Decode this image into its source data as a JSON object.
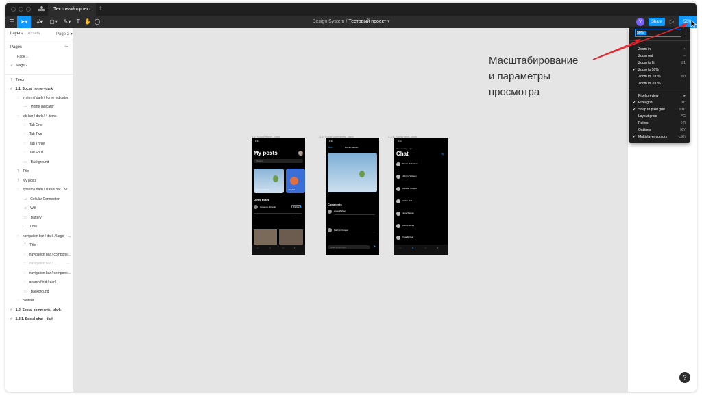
{
  "titlebar": {
    "tab_title": "Тестовый проект",
    "plus": "+"
  },
  "toolbar": {
    "breadcrumb_team": "Design System",
    "breadcrumb_sep": "/",
    "breadcrumb_file": "Тестовый проект",
    "avatar_letter": "V",
    "share_label": "Share",
    "zoom_value": "50%"
  },
  "layers_panel": {
    "tab_layers": "Layers",
    "tab_assets": "Assets",
    "page_selector": "Page 2",
    "pages_heading": "Pages",
    "add_page": "+",
    "pages": [
      "Page 1",
      "Page 2"
    ],
    "current_page_check": "✔",
    "layers": [
      {
        "label": "Текст",
        "glyph": "T"
      },
      {
        "label": "1.1. Social home - dark",
        "glyph": "#"
      },
      {
        "label": "system / dark / home indicator",
        "glyph": "::"
      },
      {
        "label": "Home Indicator",
        "glyph": "—"
      },
      {
        "label": "tab bar / dark / 4 items",
        "glyph": "::"
      },
      {
        "label": "Tab One",
        "glyph": "::"
      },
      {
        "label": "Tab Two",
        "glyph": "::"
      },
      {
        "label": "Tab Three",
        "glyph": "::"
      },
      {
        "label": "Tab Four",
        "glyph": "::"
      },
      {
        "label": "Background",
        "glyph": "▭"
      },
      {
        "label": "Title",
        "glyph": "T"
      },
      {
        "label": "My posts",
        "glyph": "T"
      },
      {
        "label": "system / dark / status bar / 3e...",
        "glyph": "::"
      },
      {
        "label": "Cellular Connection",
        "glyph": "⊿"
      },
      {
        "label": "Wifi",
        "glyph": "≋"
      },
      {
        "label": "Battery",
        "glyph": "▭"
      },
      {
        "label": "Time",
        "glyph": "T"
      },
      {
        "label": "navigation bar / dark / large + ...",
        "glyph": "::"
      },
      {
        "label": "Title",
        "glyph": "T"
      },
      {
        "label": "navigation bar / compone...",
        "glyph": "::"
      },
      {
        "label": "navigation bar / ...",
        "glyph": "::"
      },
      {
        "label": "navigation bar / compone...",
        "glyph": "::"
      },
      {
        "label": "search field / dark",
        "glyph": "::"
      },
      {
        "label": "Background",
        "glyph": "▭"
      },
      {
        "label": "content",
        "glyph": "::"
      },
      {
        "label": "1.2. Social comments - dark",
        "glyph": "#"
      },
      {
        "label": "1.3.1. Social chat - dark",
        "glyph": "#"
      }
    ]
  },
  "canvas": {
    "frames": [
      {
        "label": "1.1. Social home - dark"
      },
      {
        "label": "1.2. Social comments - dark"
      },
      {
        "label": "1.3.1. Social chat - dark"
      }
    ],
    "home": {
      "time": "9:41",
      "title": "My posts",
      "search": "Search",
      "card_caption": "Hot air balloon",
      "card2_caption": "Jellyfish",
      "other_posts": "Other posts",
      "author": "Cameron Stewart",
      "follow": "Follow"
    },
    "comments": {
      "time": "9:41",
      "back": "Back",
      "title": "Hot air balloon",
      "heading": "Comments",
      "user1": "Ange Walton",
      "user2": "Kathryn Cooper",
      "input": "Write a comment"
    },
    "chat": {
      "time": "9:41",
      "subtitle": "Wednesday, June",
      "title": "Chat",
      "contacts": [
        "Nicole Robertson",
        "Johnny Watson",
        "Annette Cooper",
        "Arthur Bell",
        "Jane Warren",
        "Morris Henry",
        "Irma Flores"
      ]
    }
  },
  "view_menu": {
    "input_value": "50%",
    "items_group1": [
      {
        "label": "Zoom in",
        "shortcut": "+",
        "checked": false
      },
      {
        "label": "Zoom out",
        "shortcut": "−",
        "checked": false
      },
      {
        "label": "Zoom to fit",
        "shortcut": "⇧1",
        "checked": false
      },
      {
        "label": "Zoom to 50%",
        "shortcut": "",
        "checked": true
      },
      {
        "label": "Zoom to 100%",
        "shortcut": "⇧0",
        "checked": false
      },
      {
        "label": "Zoom to 200%",
        "shortcut": "",
        "checked": false
      }
    ],
    "items_group2": [
      {
        "label": "Pixel preview",
        "shortcut": "▸",
        "checked": false
      },
      {
        "label": "Pixel grid",
        "shortcut": "⌘'",
        "checked": true
      },
      {
        "label": "Snap to pixel grid",
        "shortcut": "⇧⌘'",
        "checked": true
      },
      {
        "label": "Layout grids",
        "shortcut": "^G",
        "checked": false
      },
      {
        "label": "Rulers",
        "shortcut": "⇧R",
        "checked": false
      },
      {
        "label": "Outlines",
        "shortcut": "⌘Y",
        "checked": false
      },
      {
        "label": "Multiplayer cursors",
        "shortcut": "⌥⌘\\",
        "checked": true
      }
    ],
    "check_glyph": "✔"
  },
  "annotation": {
    "line1": "Масштабирование",
    "line2": "и параметры",
    "line3": "просмотра"
  },
  "help_label": "?",
  "colors": {
    "accent": "#0d99ff",
    "arrow": "#e8232b",
    "menu_bg": "#1e1e1e",
    "toolbar_bg": "#2c2c2c"
  }
}
